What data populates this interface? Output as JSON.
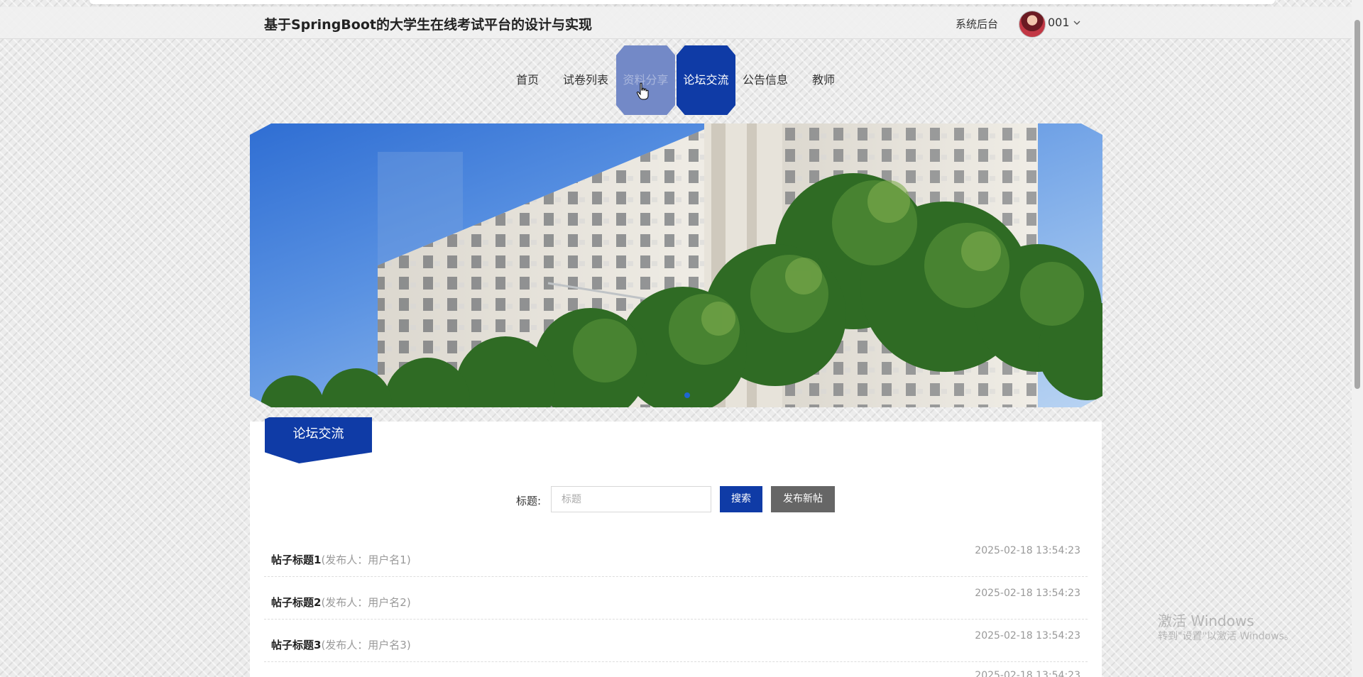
{
  "header": {
    "site_title": "基于SpringBoot的大学生在线考试平台的设计与实现",
    "admin_link": "系统后台",
    "username": "001"
  },
  "nav": {
    "items": [
      {
        "label": "首页",
        "state": "normal"
      },
      {
        "label": "试卷列表",
        "state": "normal"
      },
      {
        "label": "资料分享",
        "state": "hover"
      },
      {
        "label": "论坛交流",
        "state": "active"
      },
      {
        "label": "公告信息",
        "state": "normal"
      },
      {
        "label": "教师",
        "state": "normal"
      }
    ]
  },
  "forum": {
    "section_title": "论坛交流",
    "search_label": "标题:",
    "search_placeholder": "标题",
    "search_button": "搜索",
    "new_post_button": "发布新帖",
    "posts": [
      {
        "title": "帖子标题1",
        "author": "(发布人：用户名1)",
        "time": "2025-02-18 13:54:23"
      },
      {
        "title": "帖子标题2",
        "author": "(发布人：用户名2)",
        "time": "2025-02-18 13:54:23"
      },
      {
        "title": "帖子标题3",
        "author": "(发布人：用户名3)",
        "time": "2025-02-18 13:54:23"
      },
      {
        "title": "",
        "author": "",
        "time": "2025-02-18 13:54:23"
      }
    ]
  },
  "watermark": {
    "line1": "激活 Windows",
    "line2": "转到\"设置\"以激活 Windows。"
  },
  "colors": {
    "primary": "#0f3ba6",
    "hover": "#7389c7",
    "secondary_button": "#666666"
  }
}
